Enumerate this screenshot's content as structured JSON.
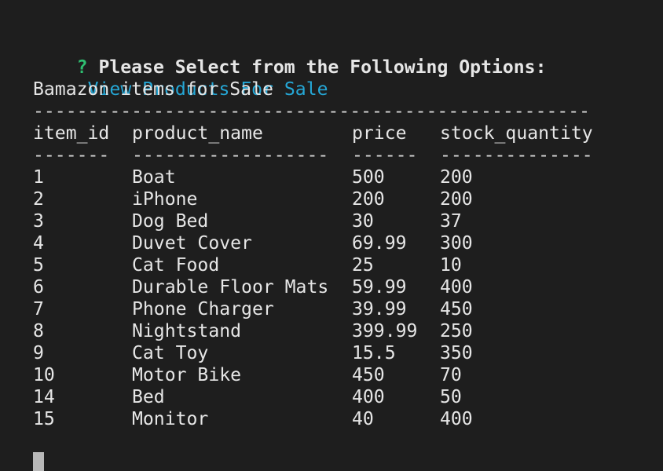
{
  "prompt": {
    "mark": "?",
    "question": "Please Select from the Following Options:",
    "answer": "View Products For Sale"
  },
  "title": "Bamazon items for Sale",
  "top_rule": "---------------------------------------------------",
  "table": {
    "headers": [
      "item_id",
      "product_name",
      "price",
      "stock_quantity"
    ],
    "separators": [
      "-------",
      "------------------",
      "------",
      "--------------"
    ],
    "rows": [
      [
        "1",
        "Boat",
        "500",
        "200"
      ],
      [
        "2",
        "iPhone",
        "200",
        "200"
      ],
      [
        "3",
        "Dog Bed",
        "30",
        "37"
      ],
      [
        "4",
        "Duvet Cover",
        "69.99",
        "300"
      ],
      [
        "5",
        "Cat Food",
        "25",
        "10"
      ],
      [
        "6",
        "Durable Floor Mats",
        "59.99",
        "400"
      ],
      [
        "7",
        "Phone Charger",
        "39.99",
        "450"
      ],
      [
        "8",
        "Nightstand",
        "399.99",
        "250"
      ],
      [
        "9",
        "Cat Toy",
        "15.5",
        "350"
      ],
      [
        "10",
        "Motor Bike",
        "450",
        "70"
      ],
      [
        "14",
        "Bed",
        "400",
        "50"
      ],
      [
        "15",
        "Monitor",
        "40",
        "400"
      ]
    ]
  },
  "colors": {
    "background": "#1e1e1e",
    "text": "#e6e6e6",
    "prompt_mark": "#2fbf71",
    "answer": "#25a7d6",
    "cursor": "#b8b8b8"
  }
}
